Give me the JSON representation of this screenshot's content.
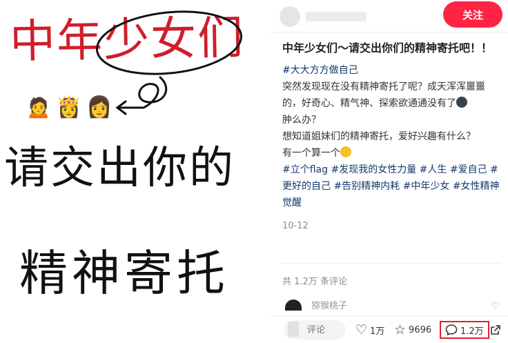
{
  "image": {
    "line1": "中年少女们",
    "line2": "请交出你的",
    "line3": "精神寄托",
    "emojis": [
      "🙍",
      "👸",
      "👩"
    ]
  },
  "author": {
    "follow_label": "关注"
  },
  "note": {
    "title": "中年少女们～请交出你们的精神寄托吧！！",
    "tag_first": "#大大方方做自己",
    "body_1": "突然发现现在没有精神寄托了呢？成天浑浑噩噩的，好奇心、精气神、探索欲通通没有了",
    "body_2": "肿么办？",
    "body_3": "想知道姐妹们的精神寄托，爱好兴趣有什么？",
    "body_4": "有一个算一个",
    "tags": [
      "#立个flag",
      "#发现我的女性力量",
      "#人生",
      "#爱自己",
      "#更好的自己",
      "#告别精神内耗",
      "#中年少女",
      "#女性精神觉醒"
    ],
    "date": "10-12"
  },
  "comments": {
    "count_label": "共 1.2万 条评论",
    "peek_name": "猕猴桃子"
  },
  "bottom_bar": {
    "input_placeholder": "评论",
    "like_count": "1万",
    "collect_count": "9696",
    "comment_count": "1.2万"
  },
  "colors": {
    "accent": "#ff2442",
    "tag": "#13386c",
    "handwriting_red": "#d01d2b",
    "highlight_box": "#e11d2a"
  }
}
